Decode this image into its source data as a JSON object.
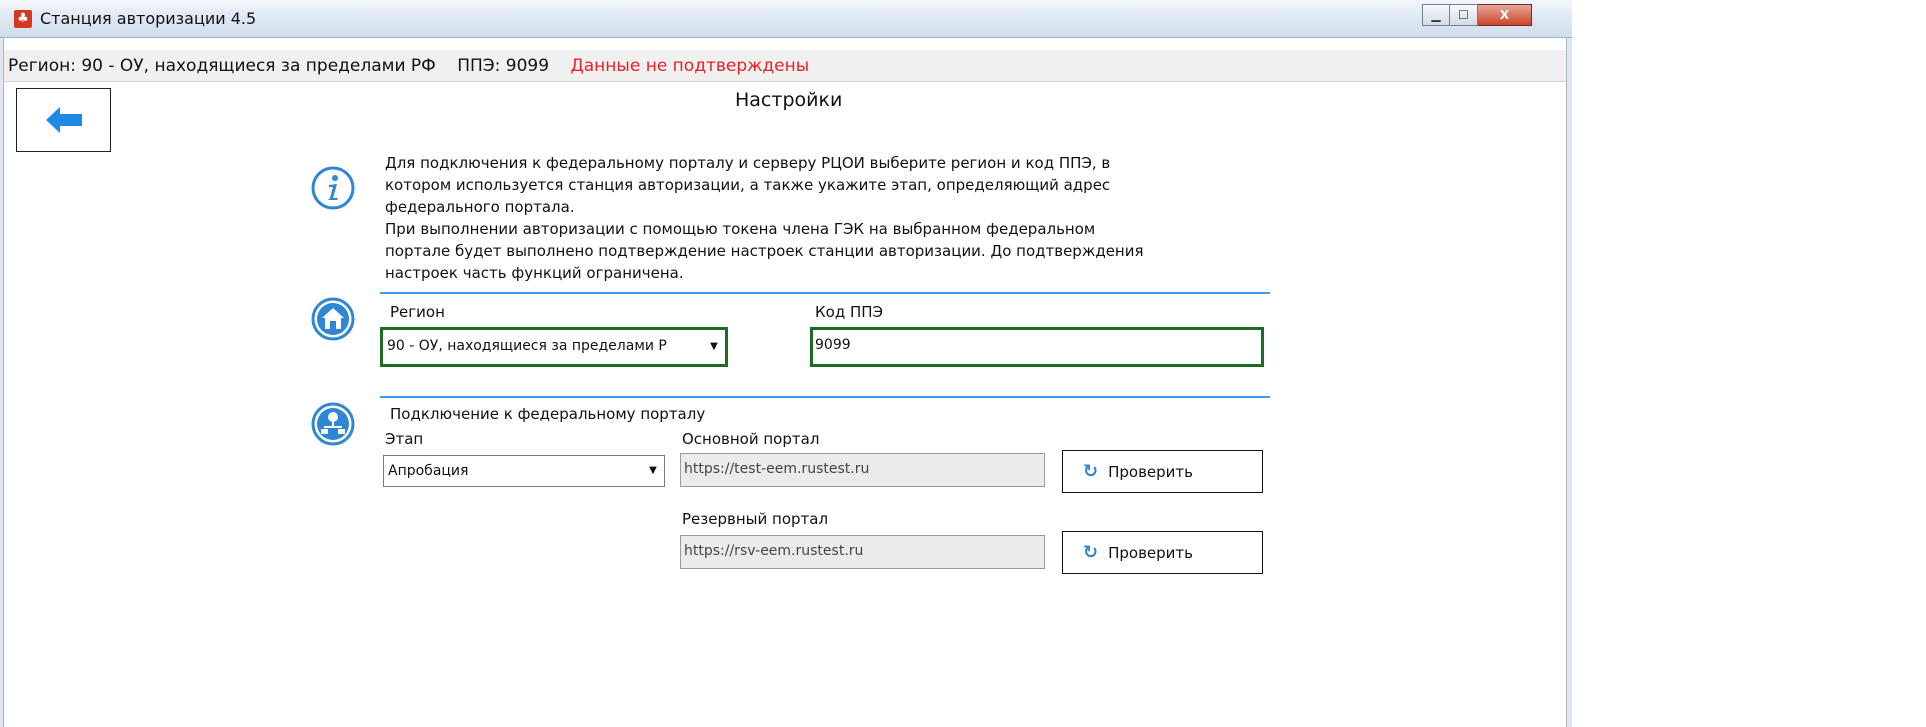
{
  "window": {
    "title": "Станция авторизации 4.5",
    "app_icon_glyph": "♣",
    "minimize_glyph": "▁",
    "maximize_glyph": "☐",
    "close_glyph": "X"
  },
  "status": {
    "region": "Регион: 90 - ОУ, находящиеся за пределами РФ",
    "ppe": "ППЭ: 9099",
    "warning": "Данные не подтверждены",
    "warning_color": "#e8212b"
  },
  "page": {
    "title": "Настройки",
    "back_icon": "arrow-left-icon"
  },
  "info": {
    "icon": "info-icon",
    "lines": [
      "Для подключения к федеральному порталу и серверу РЦОИ выберите регион и код ППЭ, в",
      "котором используется станция авторизации, а также укажите этап, определяющий адрес",
      "федерального портала.",
      "При выполнении авторизации с помощью токена члена ГЭК на выбранном федеральном",
      "портале будет выполнено подтверждение настроек станции авторизации. До подтверждения",
      "настроек часть функций ограничена."
    ]
  },
  "region_section": {
    "icon": "home-icon",
    "region_label": "Регион",
    "region_value": "90 - ОУ, находящиеся за пределами Р",
    "ppe_label": "Код ППЭ",
    "ppe_value": "9099"
  },
  "portal_section": {
    "icon": "network-icon",
    "heading": "Подключение к федеральному порталу",
    "stage_label": "Этап",
    "stage_value": "Апробация",
    "main_portal_label": "Основной портал",
    "main_portal_url": "https://test-eem.rustest.ru",
    "backup_portal_label": "Резервный портал",
    "backup_portal_url": "https://rsv-eem.rustest.ru",
    "check_label": "Проверить",
    "check_icon": "refresh-icon"
  },
  "colors": {
    "accent_blue": "#3ba0e6",
    "valid_green": "#1e6b24"
  }
}
